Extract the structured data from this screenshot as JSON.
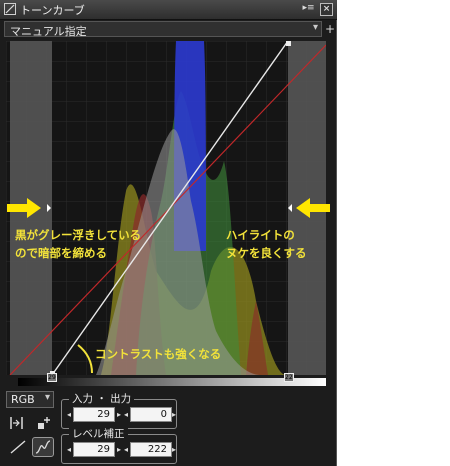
{
  "window": {
    "title": "トーンカーブ",
    "expand_icon": "panel-expand-icon",
    "close_icon": "close-icon"
  },
  "preset": {
    "value": "マニュアル指定",
    "chevron": "▾",
    "add": "+"
  },
  "colors": {
    "curve_white": "#e8e8e8",
    "reference_red": "#c0282a",
    "annotation": "#f2e23a",
    "arrow": "#ffe600",
    "clip_shade": "#5a5a5a"
  },
  "annotations": {
    "left_line1": "黒がグレー浮きしている",
    "left_line2": "ので暗部を締める",
    "right_line1": "ハイライトの",
    "right_line2": "ヌケを良くする",
    "bottom": "コントラストも強くなる"
  },
  "sliders": {
    "black_point_label": "29",
    "white_point_label": "222"
  },
  "controls": {
    "channel": "RGB",
    "channel_chevron": "▾",
    "io_group_label": "入力 ・ 出力",
    "input_value": "29",
    "output_value": "0",
    "level_group_label": "レベル補正",
    "level_black": "29",
    "level_white": "222",
    "spin_left": "◂",
    "spin_right": "▸"
  },
  "icons": {
    "app": "tone-curve-app-icon",
    "auto_levels": "auto-levels-icon",
    "add_point": "add-point-icon",
    "linear_curve": "linear-curve-tool-icon",
    "smooth_curve": "smooth-curve-tool-icon"
  }
}
